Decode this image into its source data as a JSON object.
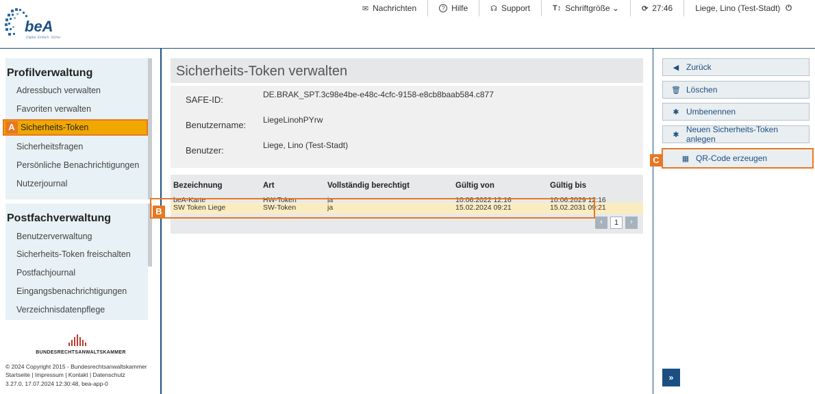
{
  "logo": {
    "text": "beA",
    "tagline": "Digital. Einfach. Sicher."
  },
  "topnav": [
    {
      "icon": "envelope-icon",
      "glyph": "✉",
      "label": "Nachrichten"
    },
    {
      "icon": "help-icon",
      "glyph": "?",
      "label": "Hilfe"
    },
    {
      "icon": "headset-icon",
      "glyph": "☊",
      "label": "Support"
    },
    {
      "icon": "font-size-icon",
      "glyph": "T↕",
      "label": "Schriftgröße ⌄"
    },
    {
      "icon": "refresh-icon",
      "glyph": "⟳",
      "label": "27:46"
    },
    {
      "icon": "power-icon",
      "glyph": "⏻",
      "label": "Liege, Lino (Test-Stadt)"
    }
  ],
  "sidebar": {
    "section1_title": "Profilverwaltung",
    "section1_items": [
      "Adressbuch verwalten",
      "Favoriten verwalten",
      "Sicherheits-Token",
      "Sicherheitsfragen",
      "Persönliche Benachrichtigungen",
      "Nutzerjournal"
    ],
    "section2_title": "Postfachverwaltung",
    "section2_items": [
      "Benutzerverwaltung",
      "Sicherheits-Token freischalten",
      "Postfachjournal",
      "Eingangsbenachrichtigungen",
      "Verzeichnisdatenpflege"
    ],
    "brak_name": "BUNDESRECHTSANWALTSKAMMER",
    "footer": {
      "copyright": "© 2024 Copyright 2015 - Bundesrechtsanwaltskammer",
      "links": "Startseite | Impressum | Kontakt | Datenschutz",
      "version": "3.27.0, 17.07.2024 12:30:48, bea-app-0"
    }
  },
  "markers": {
    "a": "A",
    "b": "B",
    "c": "C"
  },
  "main": {
    "title": "Sicherheits-Token verwalten",
    "info": [
      {
        "label": "SAFE-ID:",
        "value": "DE.BRAK_SPT.3c98e4be-e48c-4cfc-9158-e8cb8baab584.c877"
      },
      {
        "label": "Benutzername:",
        "value": "LiegeLinohPYrw"
      },
      {
        "label": "Benutzer:",
        "value": "Liege, Lino (Test-Stadt)"
      }
    ],
    "table": {
      "headers": [
        "Bezeichnung",
        "Art",
        "Vollständig berechtigt",
        "Gültig von",
        "Gültig bis"
      ],
      "rows": [
        [
          "beA-Karte",
          "HW-Token",
          "ja",
          "10.06.2022 12:16",
          "10.06.2029 12:16"
        ],
        [
          "SW Token Liege",
          "SW-Token",
          "ja",
          "15.02.2024 09:21",
          "15.02.2031 09:21"
        ]
      ],
      "page": "1"
    }
  },
  "actions": [
    {
      "icon": "arrow-left-circle-icon",
      "glyph": "◀",
      "label": "Zurück"
    },
    {
      "icon": "trash-icon",
      "glyph": "🗑",
      "label": "Löschen"
    },
    {
      "icon": "gear-icon",
      "glyph": "✱",
      "label": "Umbenennen"
    },
    {
      "icon": "gear-icon",
      "glyph": "✱",
      "label": "Neuen Sicherheits-Token anlegen"
    },
    {
      "icon": "qr-code-icon",
      "glyph": "▦",
      "label": "QR-Code erzeugen"
    }
  ],
  "expand_label": "»",
  "colors": {
    "brand": "#1b4f82",
    "highlight": "#f0a800",
    "marker": "#e87722",
    "row_highlight": "#fbecc0"
  }
}
